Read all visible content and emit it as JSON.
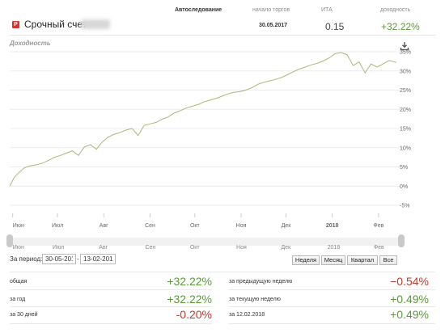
{
  "header": {
    "account_title": "Срочный счет",
    "columns": {
      "strategy_label": "Автоследование",
      "start_label": "начало торгов",
      "ita_label": "ИТА",
      "yield_label": "доходность"
    },
    "values": {
      "start": "30.05.2017",
      "ita": "0.15",
      "yield": "+32.22%"
    }
  },
  "chart": {
    "download_icon": "download-icon"
  },
  "chart_data": {
    "type": "line",
    "title": "Доходность",
    "ylabel": "",
    "xlabel": "",
    "y_ticks": [
      "35%",
      "30%",
      "25%",
      "20%",
      "15%",
      "10%",
      "5%",
      "0%",
      "-5%"
    ],
    "y_tick_values": [
      35,
      30,
      25,
      20,
      15,
      10,
      5,
      0,
      -5
    ],
    "ylim": [
      -5,
      35
    ],
    "x_ticks": [
      "Июн",
      "Июл",
      "Авг",
      "Сен",
      "Окт",
      "Ноя",
      "Дек",
      "2018",
      "Фев"
    ],
    "x_tick_dates": [
      "2017-06-01",
      "2017-07-01",
      "2017-08-01",
      "2017-09-01",
      "2017-10-01",
      "2017-11-01",
      "2017-12-01",
      "2018-01-01",
      "2018-02-01"
    ],
    "xlim": [
      "2017-05-30",
      "2018-02-13"
    ],
    "grid": true,
    "line_color": "#a8b878",
    "series": [
      {
        "x": [
          "2017-05-30",
          "2017-06-02",
          "2017-06-05",
          "2017-06-09",
          "2017-06-13",
          "2017-06-17",
          "2017-06-21",
          "2017-06-25",
          "2017-06-29",
          "2017-07-03",
          "2017-07-07",
          "2017-07-11",
          "2017-07-15",
          "2017-07-19",
          "2017-07-23",
          "2017-07-27",
          "2017-07-31",
          "2017-08-04",
          "2017-08-08",
          "2017-08-12",
          "2017-08-16",
          "2017-08-20",
          "2017-08-24",
          "2017-08-28",
          "2017-09-01",
          "2017-09-05",
          "2017-09-09",
          "2017-09-13",
          "2017-09-17",
          "2017-09-21",
          "2017-09-25",
          "2017-09-29",
          "2017-10-03",
          "2017-10-07",
          "2017-10-11",
          "2017-10-15",
          "2017-10-19",
          "2017-10-23",
          "2017-10-27",
          "2017-10-31",
          "2017-11-04",
          "2017-11-08",
          "2017-11-12",
          "2017-11-16",
          "2017-11-20",
          "2017-11-24",
          "2017-11-28",
          "2017-12-02",
          "2017-12-06",
          "2017-12-10",
          "2017-12-14",
          "2017-12-18",
          "2017-12-22",
          "2017-12-26",
          "2017-12-30",
          "2018-01-03",
          "2018-01-07",
          "2018-01-11",
          "2018-01-15",
          "2018-01-19",
          "2018-01-23",
          "2018-01-27",
          "2018-01-31",
          "2018-02-04",
          "2018-02-08",
          "2018-02-13"
        ],
        "values": [
          0,
          2.2,
          3.5,
          4.8,
          5.3,
          5.6,
          6.0,
          6.7,
          7.5,
          8.0,
          8.6,
          9.2,
          8.0,
          10.2,
          10.8,
          9.6,
          11.5,
          12.8,
          13.5,
          14.0,
          14.6,
          15.0,
          13.2,
          15.8,
          16.2,
          16.6,
          17.4,
          18.0,
          19.0,
          19.6,
          20.3,
          20.8,
          21.2,
          21.9,
          22.4,
          22.8,
          23.4,
          24.0,
          24.4,
          24.6,
          25.0,
          25.6,
          26.5,
          27.0,
          27.4,
          27.8,
          28.3,
          29.0,
          29.8,
          30.5,
          31.0,
          31.6,
          32.0,
          32.6,
          33.4,
          34.5,
          34.8,
          34.2,
          31.4,
          32.3,
          29.5,
          31.8,
          31.0,
          31.8,
          32.7,
          32.2
        ]
      }
    ]
  },
  "navigator": {
    "labels": [
      "Июн",
      "Июл",
      "Авг",
      "Сен",
      "Окт",
      "Ноя",
      "Дек",
      "2018",
      "Фев"
    ]
  },
  "period": {
    "label": "За период:",
    "from": "30-05-2017",
    "dash": "-",
    "to": "13-02-2018",
    "buttons": [
      "Неделя",
      "Месяц",
      "Квартал",
      "Все"
    ]
  },
  "stats": {
    "left": [
      {
        "label": "общая",
        "value": "+32.22%",
        "positive": true
      },
      {
        "label": "за год",
        "value": "+32.22%",
        "positive": true
      },
      {
        "label": "за 30 дней",
        "value": "-0.20%",
        "positive": false
      }
    ],
    "right": [
      {
        "label": "за предыдущую неделю",
        "value": "−0.54%",
        "positive": false
      },
      {
        "label": "за текущую неделю",
        "value": "+0.49%",
        "positive": true
      },
      {
        "label": "за 12.02.2018",
        "value": "+0.49%",
        "positive": true
      }
    ],
    "colors": {
      "positive": "#5a9a3a",
      "negative": "#c0392b"
    }
  }
}
